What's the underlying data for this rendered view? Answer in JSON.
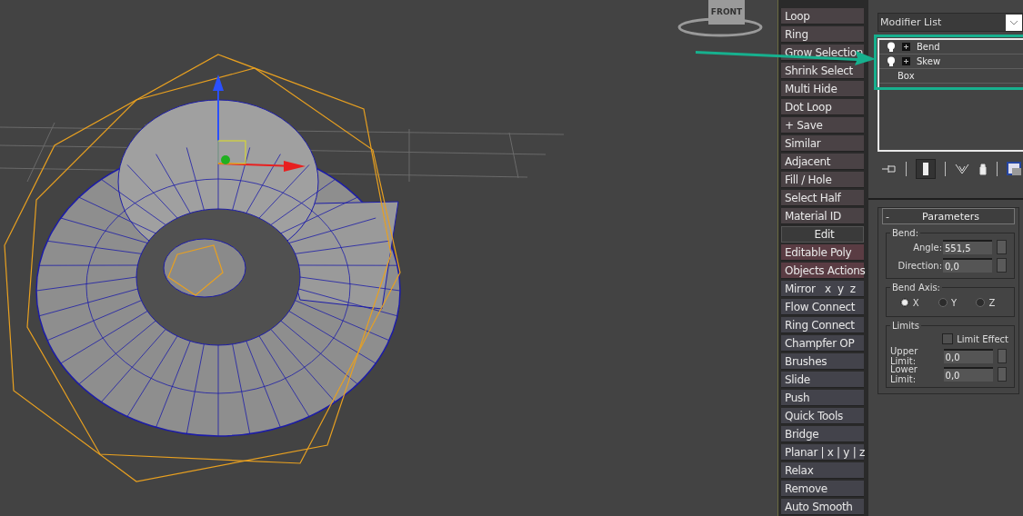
{
  "viewport": {
    "viewcube_label": "FRONT"
  },
  "tool_buttons": [
    {
      "label": "Loop",
      "kind": "warm"
    },
    {
      "label": "Ring",
      "kind": "warm"
    },
    {
      "label": "Grow Selection",
      "kind": "warm"
    },
    {
      "label": "Shrink Select",
      "kind": "warm"
    },
    {
      "label": "Multi Hide",
      "kind": "warm"
    },
    {
      "label": "Dot Loop",
      "kind": "warm"
    },
    {
      "label": "+ Save",
      "kind": "warm"
    },
    {
      "label": "Similar",
      "kind": "warm"
    },
    {
      "label": "Adjacent",
      "kind": "warm"
    },
    {
      "label": "Fill / Hole",
      "kind": "warm"
    },
    {
      "label": "Select Half",
      "kind": "warm"
    },
    {
      "label": "Material ID",
      "kind": "warm"
    },
    {
      "label": "Edit",
      "kind": "header"
    },
    {
      "label": "Editable Poly",
      "kind": "accent"
    },
    {
      "label": "Objects Actions",
      "kind": "accent"
    },
    {
      "label": "Mirror   x  y  z",
      "kind": "cool"
    },
    {
      "label": "Flow Connect",
      "kind": "cool"
    },
    {
      "label": "Ring Connect",
      "kind": "cool"
    },
    {
      "label": "Champfer OP",
      "kind": "cool"
    },
    {
      "label": "Brushes",
      "kind": "cool"
    },
    {
      "label": "Slide",
      "kind": "cool"
    },
    {
      "label": "Push",
      "kind": "cool"
    },
    {
      "label": "Quick Tools",
      "kind": "cool"
    },
    {
      "label": "Bridge",
      "kind": "cool"
    },
    {
      "label": "Planar | x | y | z",
      "kind": "cool"
    },
    {
      "label": "Relax",
      "kind": "cool"
    },
    {
      "label": "Remove",
      "kind": "cool"
    },
    {
      "label": "Auto Smooth",
      "kind": "cool"
    }
  ],
  "modifier_panel": {
    "dropdown": "Modifier List",
    "stack": [
      {
        "label": "Bend",
        "kind": "modifier"
      },
      {
        "label": "Skew",
        "kind": "modifier"
      },
      {
        "label": "Box",
        "kind": "base"
      }
    ]
  },
  "parameters": {
    "title": "Parameters",
    "collapse": "-",
    "bend": {
      "title": "Bend:",
      "angle_label": "Angle:",
      "angle": "551,5",
      "direction_label": "Direction:",
      "direction": "0,0"
    },
    "bend_axis": {
      "title": "Bend Axis:",
      "options": [
        {
          "label": "X",
          "selected": true
        },
        {
          "label": "Y",
          "selected": false
        },
        {
          "label": "Z",
          "selected": false
        }
      ]
    },
    "limits": {
      "title": "Limits",
      "limit_effect": {
        "label": "Limit Effect",
        "checked": false
      },
      "upper_label": "Upper Limit:",
      "upper": "0,0",
      "lower_label": "Lower Limit:",
      "lower": "0,0"
    }
  }
}
